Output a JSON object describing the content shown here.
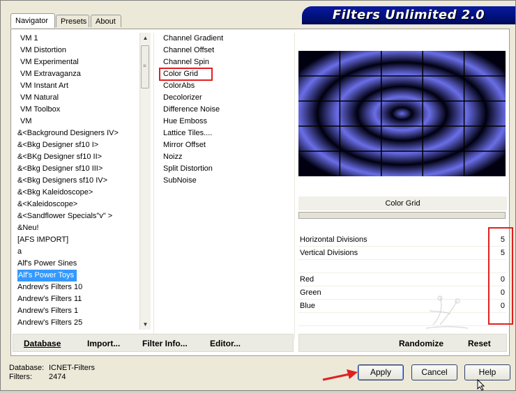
{
  "tabs": [
    {
      "label": "Navigator",
      "active": true
    },
    {
      "label": "Presets",
      "active": false
    },
    {
      "label": "About",
      "active": false
    }
  ],
  "logo": "Filters Unlimited 2.0",
  "categories": {
    "items": [
      "VM 1",
      "VM Distortion",
      "VM Experimental",
      "VM Extravaganza",
      "VM Instant Art",
      "VM Natural",
      "VM Toolbox",
      "VM",
      "&<Background Designers IV>",
      "&<Bkg Designer sf10 I>",
      "&<BKg Designer sf10 II>",
      "&<Bkg Designer sf10 III>",
      "&<Bkg Designers sf10 IV>",
      "&<Bkg Kaleidoscope>",
      "&<Kaleidoscope>",
      "&<Sandflower Specials\"v\" >",
      "&Neu!",
      "[AFS IMPORT]",
      "a",
      "Alf's Power Sines",
      "Alf's Power Toys",
      "Andrew's Filters 10",
      "Andrew's Filters 11",
      "Andrew's Filters 1",
      "Andrew's Filters 25"
    ],
    "selected": "Alf's Power Toys"
  },
  "filters": {
    "items": [
      "Channel Gradient",
      "Channel Offset",
      "Channel Spin",
      "Color Grid",
      "ColorAbs",
      "Decolorizer",
      "Difference Noise",
      "Hue Emboss",
      "Lattice Tiles....",
      "Mirror Offset",
      "Noizz",
      "Split Distortion",
      "SubNoise"
    ],
    "selected": "Color Grid"
  },
  "preview": {
    "grid_cols": 5,
    "grid_rows": 5,
    "ring_color": "#6a6ee8",
    "dark_color": "#000010"
  },
  "filter_title": "Color Grid",
  "params": [
    {
      "label": "Horizontal Divisions",
      "value": "5"
    },
    {
      "label": "Vertical Divisions",
      "value": "5"
    },
    {
      "label": "",
      "value": ""
    },
    {
      "label": "Red",
      "value": "0"
    },
    {
      "label": "Green",
      "value": "0"
    },
    {
      "label": "Blue",
      "value": "0"
    }
  ],
  "left_toolbar": {
    "database": "Database",
    "import": "Import...",
    "filter_info": "Filter Info...",
    "editor": "Editor..."
  },
  "right_toolbar": {
    "randomize": "Randomize",
    "reset": "Reset"
  },
  "status": {
    "database_label": "Database:",
    "database_value": "ICNET-Filters",
    "filters_label": "Filters:",
    "filters_value": "2474"
  },
  "buttons": {
    "apply": "Apply",
    "cancel": "Cancel",
    "help": "Help"
  },
  "colors": {
    "selection": "#3399ff",
    "highlight_box": "#e02020",
    "logo_bg": "#00107a"
  }
}
